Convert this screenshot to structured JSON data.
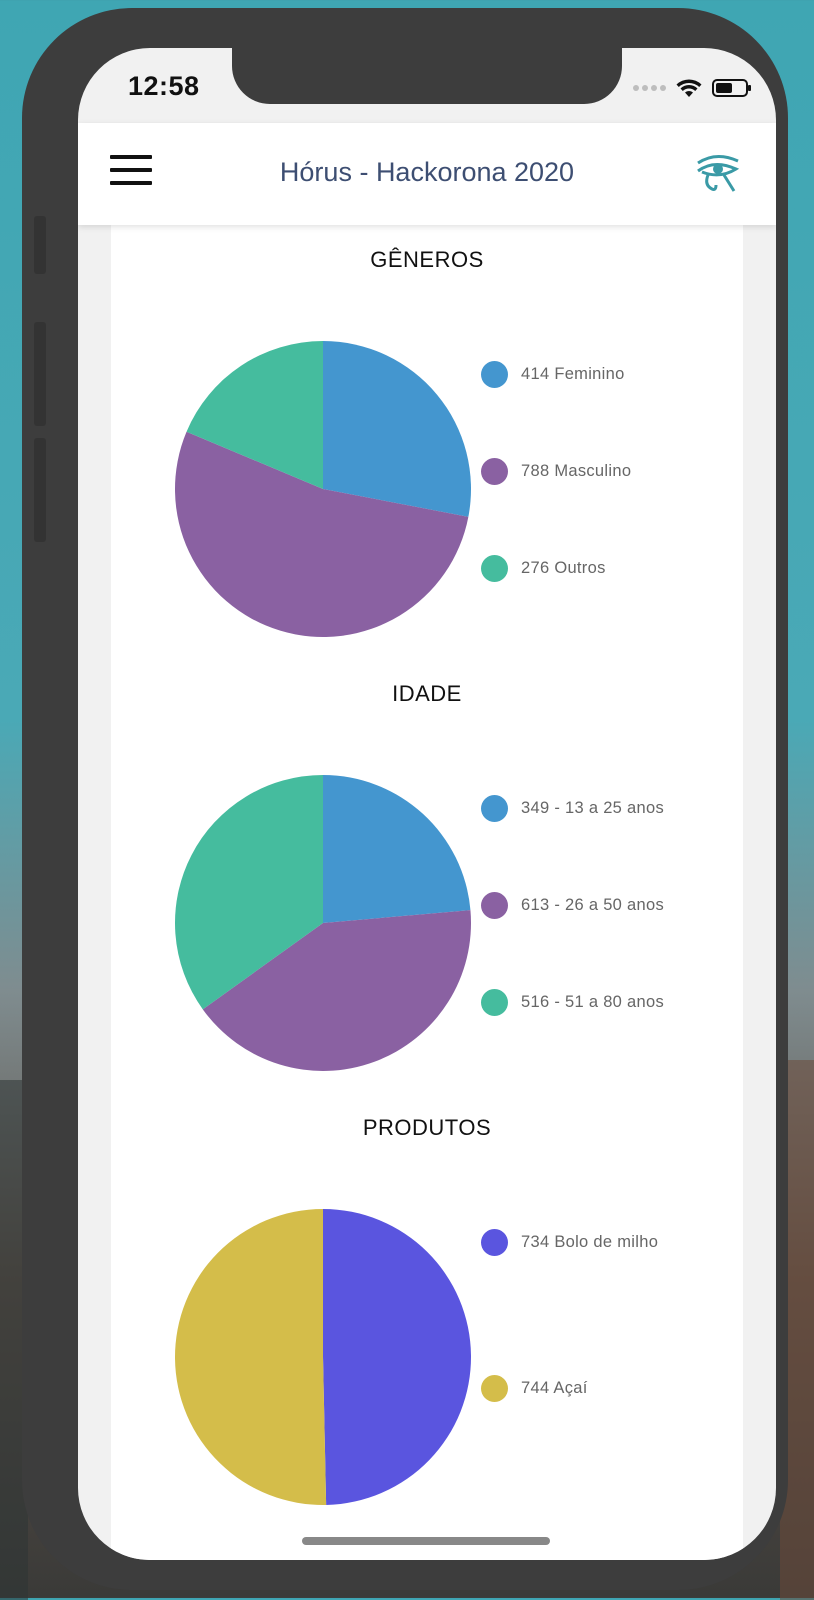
{
  "status_bar": {
    "time": "12:58"
  },
  "header": {
    "title": "Hórus - Hackorona 2020",
    "menu_icon": "hamburger-menu-icon",
    "logo_icon": "eye-of-horus-icon"
  },
  "colors": {
    "blue": "#4496cf",
    "purple": "#8a61a2",
    "teal": "#45bc9e",
    "indigo": "#5a55df",
    "gold": "#d4bd4a"
  },
  "chart_data": [
    {
      "type": "pie",
      "title": "GÊNEROS",
      "series": [
        {
          "label": "414 Feminino",
          "value": 414,
          "color": "#4496cf"
        },
        {
          "label": "788 Masculino",
          "value": 788,
          "color": "#8a61a2"
        },
        {
          "label": "276 Outros",
          "value": 276,
          "color": "#45bc9e"
        }
      ]
    },
    {
      "type": "pie",
      "title": "IDADE",
      "series": [
        {
          "label": "349 - 13 a 25 anos",
          "value": 349,
          "color": "#4496cf"
        },
        {
          "label": "613 - 26 a 50 anos",
          "value": 613,
          "color": "#8a61a2"
        },
        {
          "label": "516 - 51 a 80 anos",
          "value": 516,
          "color": "#45bc9e"
        }
      ]
    },
    {
      "type": "pie",
      "title": "PRODUTOS",
      "series": [
        {
          "label": "734 Bolo de milho",
          "value": 734,
          "color": "#5a55df"
        },
        {
          "label": "744 Açaí",
          "value": 744,
          "color": "#d4bd4a"
        }
      ]
    }
  ]
}
